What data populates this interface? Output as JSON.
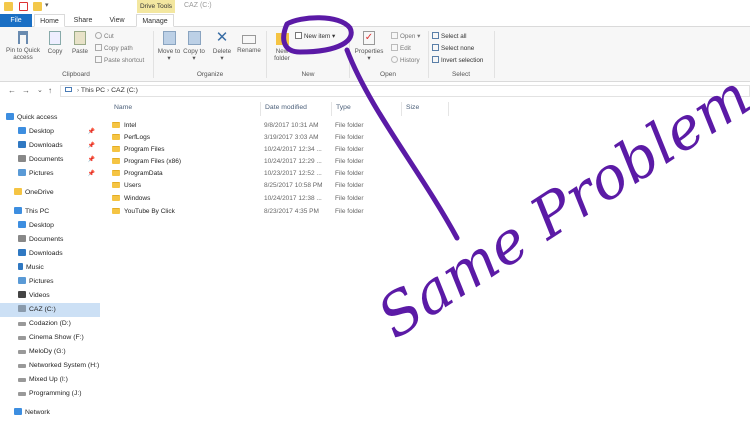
{
  "window": {
    "context_tab": "Drive Tools",
    "title": "CAZ (C:)"
  },
  "tabs": [
    "File",
    "Home",
    "Share",
    "View",
    "Manage"
  ],
  "ribbon": {
    "clipboard": {
      "label": "Clipboard",
      "pin": "Pin to Quick access",
      "copy": "Copy",
      "paste": "Paste",
      "cut": "Cut",
      "copy_path": "Copy path",
      "paste_shortcut": "Paste shortcut"
    },
    "organize": {
      "label": "Organize",
      "move_to": "Move to",
      "copy_to": "Copy to",
      "delete": "Delete",
      "rename": "Rename"
    },
    "new": {
      "label": "New",
      "new_folder": "New folder",
      "new_item": "New item"
    },
    "open": {
      "label": "Open",
      "properties": "Properties",
      "open": "Open",
      "edit": "Edit",
      "history": "History"
    },
    "select": {
      "label": "Select",
      "select_all": "Select all",
      "select_none": "Select none",
      "invert_selection": "Invert selection"
    }
  },
  "address": {
    "back": "←",
    "forward": "→",
    "recent": "⌄",
    "up": "↑",
    "crumbs": [
      "This PC",
      "CAZ (C:)"
    ]
  },
  "nav": {
    "quick_access": "Quick access",
    "quick_items": [
      "Desktop",
      "Downloads",
      "Documents",
      "Pictures"
    ],
    "onedrive": "OneDrive",
    "this_pc": "This PC",
    "pc_items": [
      "Desktop",
      "Documents",
      "Downloads",
      "Music",
      "Pictures",
      "Videos",
      "CAZ (C:)",
      "Codazion (D:)",
      "Cinema Show (F:)",
      "MeloDy (G:)",
      "Networked System (H:)",
      "Mixed Up (I:)",
      "Programming (J:)"
    ],
    "network": "Network"
  },
  "columns": {
    "name": "Name",
    "date": "Date modified",
    "type": "Type",
    "size": "Size"
  },
  "files": [
    {
      "name": "Intel",
      "date": "9/8/2017 10:31 AM",
      "type": "File folder"
    },
    {
      "name": "PerfLogs",
      "date": "3/19/2017 3:03 AM",
      "type": "File folder"
    },
    {
      "name": "Program Files",
      "date": "10/24/2017 12:34 ...",
      "type": "File folder"
    },
    {
      "name": "Program Files (x86)",
      "date": "10/24/2017 12:29 ...",
      "type": "File folder"
    },
    {
      "name": "ProgramData",
      "date": "10/23/2017 12:52 ...",
      "type": "File folder"
    },
    {
      "name": "Users",
      "date": "8/25/2017 10:58 PM",
      "type": "File folder"
    },
    {
      "name": "Windows",
      "date": "10/24/2017 12:38 ...",
      "type": "File folder"
    },
    {
      "name": "YouTube By Click",
      "date": "8/23/2017 4:35 PM",
      "type": "File folder"
    }
  ],
  "annotation": {
    "text": "Same Problem",
    "color": "#5b1aa6"
  }
}
